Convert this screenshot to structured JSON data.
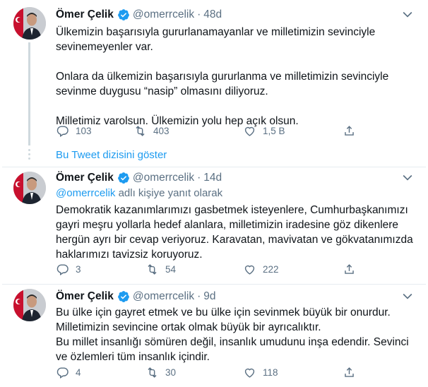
{
  "tweets": [
    {
      "name": "Ömer Çelik",
      "handle": "@omerrcelik",
      "time": "48d",
      "reply_prefix": "",
      "reply_mention": "",
      "reply_suffix": "",
      "lines": [
        "Ülkemizin başarısıyla gururlanamayanlar ve milletimizin sevinciyle",
        "sevinemeyenler var.",
        "",
        "Onlara da ülkemizin başarısıyla gururlanma ve milletimizin sevinciyle",
        "sevinme duygusu “nasip” olmasını diliyoruz.",
        "",
        "Milletimiz varolsun. Ülkemizin yolu hep açık olsun."
      ],
      "replies": "103",
      "retweets": "403",
      "likes": "1,5 B"
    },
    {
      "name": "Ömer Çelik",
      "handle": "@omerrcelik",
      "time": "14d",
      "reply_mention": "@omerrcelik",
      "reply_suffix": " adlı kişiye yanıt olarak",
      "lines": [
        "Demokratik kazanımlarımızı gasbetmek isteyenlere, Cumhurbaşkanımızı",
        "gayri meşru yollarla hedef alanlara, milletimizin iradesine göz dikenlere",
        "hergün ayrı bir cevap veriyoruz. Karavatan, mavivatan ve gökvatanımızda",
        "haklarımızı tavizsiz koruyoruz."
      ],
      "replies": "3",
      "retweets": "54",
      "likes": "222"
    },
    {
      "name": "Ömer Çelik",
      "handle": "@omerrcelik",
      "time": "9d",
      "lines": [
        "Bu ülke için gayret etmek ve bu ülke için sevinmek büyük bir onurdur.",
        "Milletimizin sevincine ortak olmak büyük bir ayrıcalıktır.",
        "Bu millet insanlığı sömüren değil, insanlık umudunu inşa edendir. Sevinci",
        "ve özlemleri tüm insanlık içindir."
      ],
      "replies": "4",
      "retweets": "30",
      "likes": "118"
    }
  ],
  "show_thread": "Bu Tweet dizisini göster",
  "icons": {
    "verified": "verified-badge-icon",
    "caret": "chevron-down-icon",
    "reply": "reply-icon",
    "retweet": "retweet-icon",
    "like": "heart-icon",
    "share": "share-icon"
  },
  "colors": {
    "link": "#1d9bf0",
    "muted": "#5b7083",
    "divider": "#e6ecf0"
  }
}
